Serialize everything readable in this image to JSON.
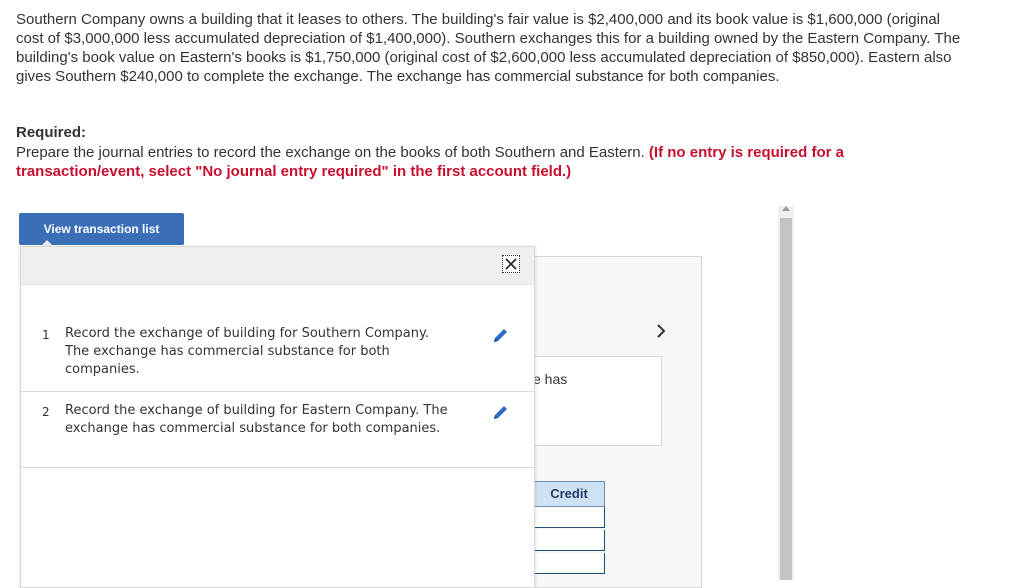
{
  "problem": {
    "statement": "Southern Company owns a building that it leases to others. The building's fair value is $2,400,000 and its book value is $1,600,000 (original cost of $3,000,000 less accumulated depreciation of $1,400,000). Southern exchanges this for a building owned by the Eastern Company. The building's book value on Eastern's books is $1,750,000 (original cost of $2,600,000 less accumulated depreciation of $850,000). Eastern also gives Southern $240,000 to complete the exchange. The exchange has commercial substance for both companies."
  },
  "required": {
    "heading": "Required:",
    "text": "Prepare the journal entries to record the exchange on the books of both Southern and Eastern.",
    "note": "(If no entry is required for a transaction/event, select \"No journal entry required\" in the first account field.)"
  },
  "worksheet": {
    "partial_text": "e has",
    "credit_header": "Credit",
    "next_icon": "chevron-right-icon"
  },
  "transaction_list": {
    "button_label": "View transaction list",
    "close_icon": "close-icon",
    "items": [
      {
        "num": "1",
        "text": "Record the exchange of building for Southern Company. The exchange has commercial substance for both companies.",
        "icon": "edit-pencil-icon"
      },
      {
        "num": "2",
        "text": "Record the exchange of building for Eastern Company. The exchange has commercial substance for both companies.",
        "icon": "edit-pencil-icon"
      }
    ]
  },
  "colors": {
    "accent": "#3a6fb8",
    "note_red": "#c8102e",
    "header_blue": "#cfe2f3"
  }
}
